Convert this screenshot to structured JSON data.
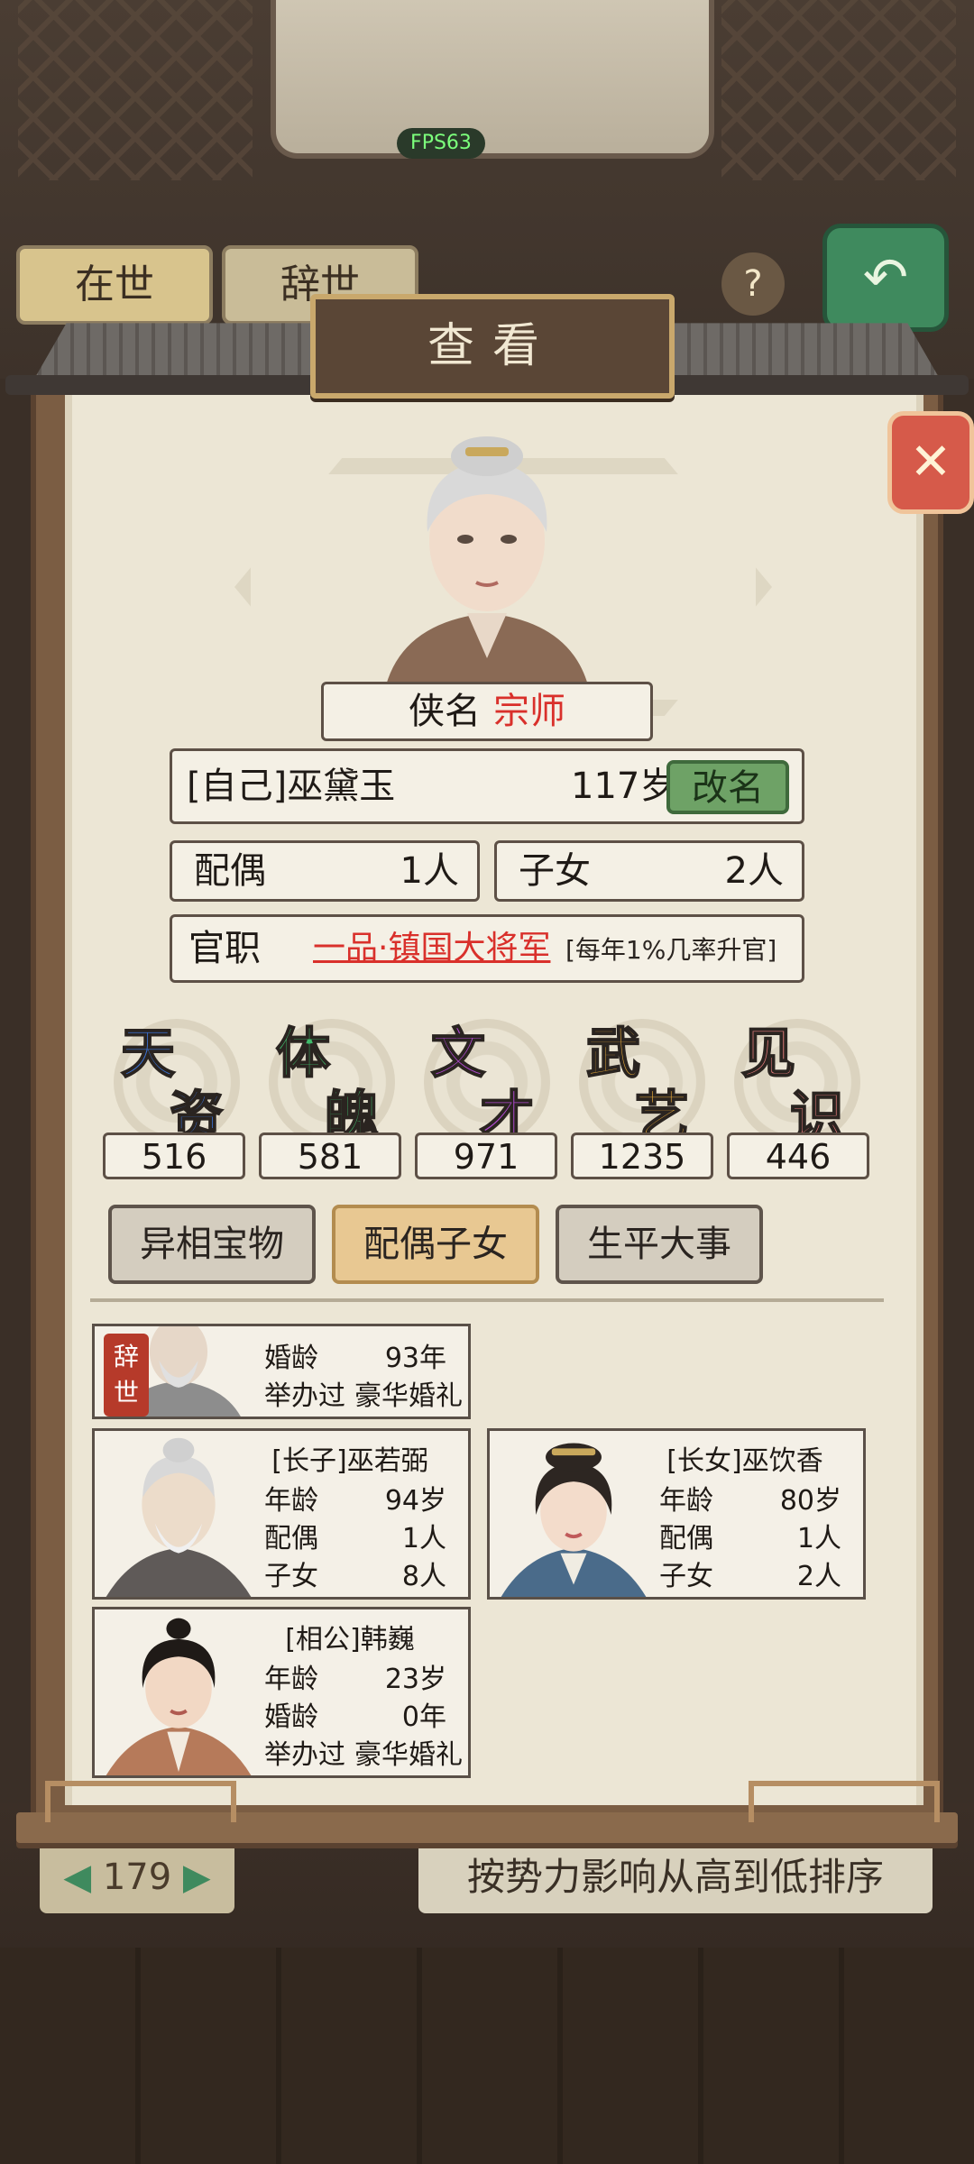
{
  "fps": "FPS63",
  "background": {
    "tab_alive": "在世",
    "tab_dead": "辞世",
    "help_icon": "?",
    "pager": "179",
    "sort_label": "按势力影响从高到低排序"
  },
  "dialog": {
    "title": "查看",
    "close_icon": "✕",
    "xia_label": "侠名",
    "xia_rank": "宗师",
    "self_name": "[自己]巫黛玉",
    "age": "117岁",
    "rename": "改名",
    "spouse_label": "配偶",
    "spouse_count": "1人",
    "children_label": "子女",
    "children_count": "2人",
    "office_label": "官职",
    "office_value": "一品·镇国大将军",
    "office_note": "[每年1%几率升官]",
    "stats": [
      {
        "c1": "天",
        "c2": "资",
        "value": "516",
        "color": "#3b73d6"
      },
      {
        "c1": "体",
        "c2": "魄",
        "value": "581",
        "color": "#3fb96a"
      },
      {
        "c1": "文",
        "c2": "才",
        "value": "971",
        "color": "#b049d0"
      },
      {
        "c1": "武",
        "c2": "艺",
        "value": "1235",
        "color": "#e6a93a"
      },
      {
        "c1": "见",
        "c2": "识",
        "value": "446",
        "color": "#e07a7a"
      }
    ],
    "tabs": [
      "异相宝物",
      "配偶子女",
      "生平大事"
    ],
    "cards": {
      "deceased": {
        "badge": "辞世",
        "row1_k": "婚龄",
        "row1_v": "93年",
        "row2_k": "举办过",
        "row2_v": "豪华婚礼"
      },
      "son": {
        "header": "[长子]巫若弼",
        "rows": [
          [
            "年龄",
            "94岁"
          ],
          [
            "配偶",
            "1人"
          ],
          [
            "子女",
            "8人"
          ]
        ]
      },
      "daughter": {
        "header": "[长女]巫饮香",
        "rows": [
          [
            "年龄",
            "80岁"
          ],
          [
            "配偶",
            "1人"
          ],
          [
            "子女",
            "2人"
          ]
        ]
      },
      "husband": {
        "header": "[相公]韩巍",
        "row1_k": "年龄",
        "row1_v": "23岁",
        "row2_k": "婚龄",
        "row2_v": "0年",
        "row3_k": "举办过",
        "row3_v": "豪华婚礼"
      }
    }
  }
}
